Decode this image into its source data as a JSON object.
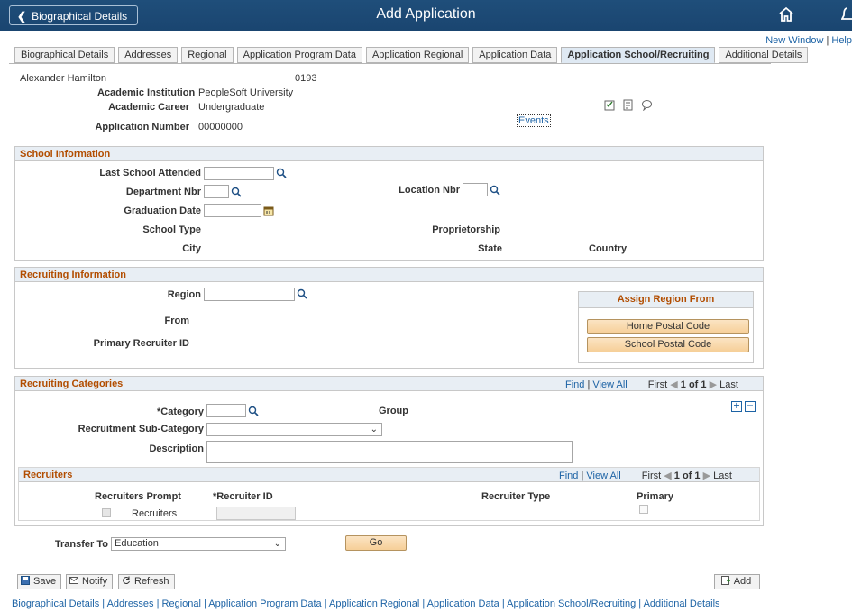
{
  "header": {
    "back_label": "Biographical Details",
    "title": "Add Application"
  },
  "top_links": {
    "new_window": "New Window",
    "separator": "|",
    "help": "Help"
  },
  "tabs": [
    {
      "label": "Biographical Details"
    },
    {
      "label": "Addresses"
    },
    {
      "label": "Regional"
    },
    {
      "label": "Application Program Data"
    },
    {
      "label": "Application Regional"
    },
    {
      "label": "Application Data"
    },
    {
      "label": "Application School/Recruiting"
    },
    {
      "label": "Additional Details"
    }
  ],
  "summary": {
    "name": "Alexander Hamilton",
    "id": "0193",
    "institution_label": "Academic Institution",
    "institution_value": "PeopleSoft University",
    "career_label": "Academic Career",
    "career_value": "Undergraduate",
    "appnum_label": "Application Number",
    "appnum_value": "00000000",
    "events_link": "Events"
  },
  "school": {
    "header": "School Information",
    "last_school_label": "Last School Attended",
    "dept_label": "Department Nbr",
    "location_label": "Location Nbr",
    "grad_date_label": "Graduation Date",
    "school_type_label": "School Type",
    "proprietorship_label": "Proprietorship",
    "city_label": "City",
    "state_label": "State",
    "country_label": "Country"
  },
  "recruiting": {
    "header": "Recruiting Information",
    "region_label": "Region",
    "from_label": "From",
    "primary_recruiter_label": "Primary Recruiter ID",
    "assign_header": "Assign Region From",
    "home_postal_button": "Home Postal Code",
    "school_postal_button": "School Postal Code"
  },
  "categories": {
    "header": "Recruiting Categories",
    "find": "Find",
    "sep": "|",
    "view_all": "View All",
    "first": "First",
    "count": "1 of 1",
    "last": "Last",
    "category_label": "*Category",
    "group_label": "Group",
    "subcategory_label": "Recruitment Sub-Category",
    "description_label": "Description"
  },
  "recruiters": {
    "header": "Recruiters",
    "find": "Find",
    "sep": "|",
    "view_all": "View All",
    "first": "First",
    "count": "1 of 1",
    "last": "Last",
    "col_prompt": "Recruiters Prompt",
    "col_id": "*Recruiter ID",
    "col_type": "Recruiter Type",
    "col_primary": "Primary",
    "row_prompt_label": "Recruiters"
  },
  "transfer": {
    "label": "Transfer To",
    "selected": "Education",
    "go_button": "Go"
  },
  "toolbar": {
    "save": "Save",
    "notify": "Notify",
    "refresh": "Refresh",
    "add": "Add"
  },
  "bottom_links": "Biographical Details | Addresses | Regional | Application Program Data | Application Regional | Application Data | Application School/Recruiting | Additional Details"
}
